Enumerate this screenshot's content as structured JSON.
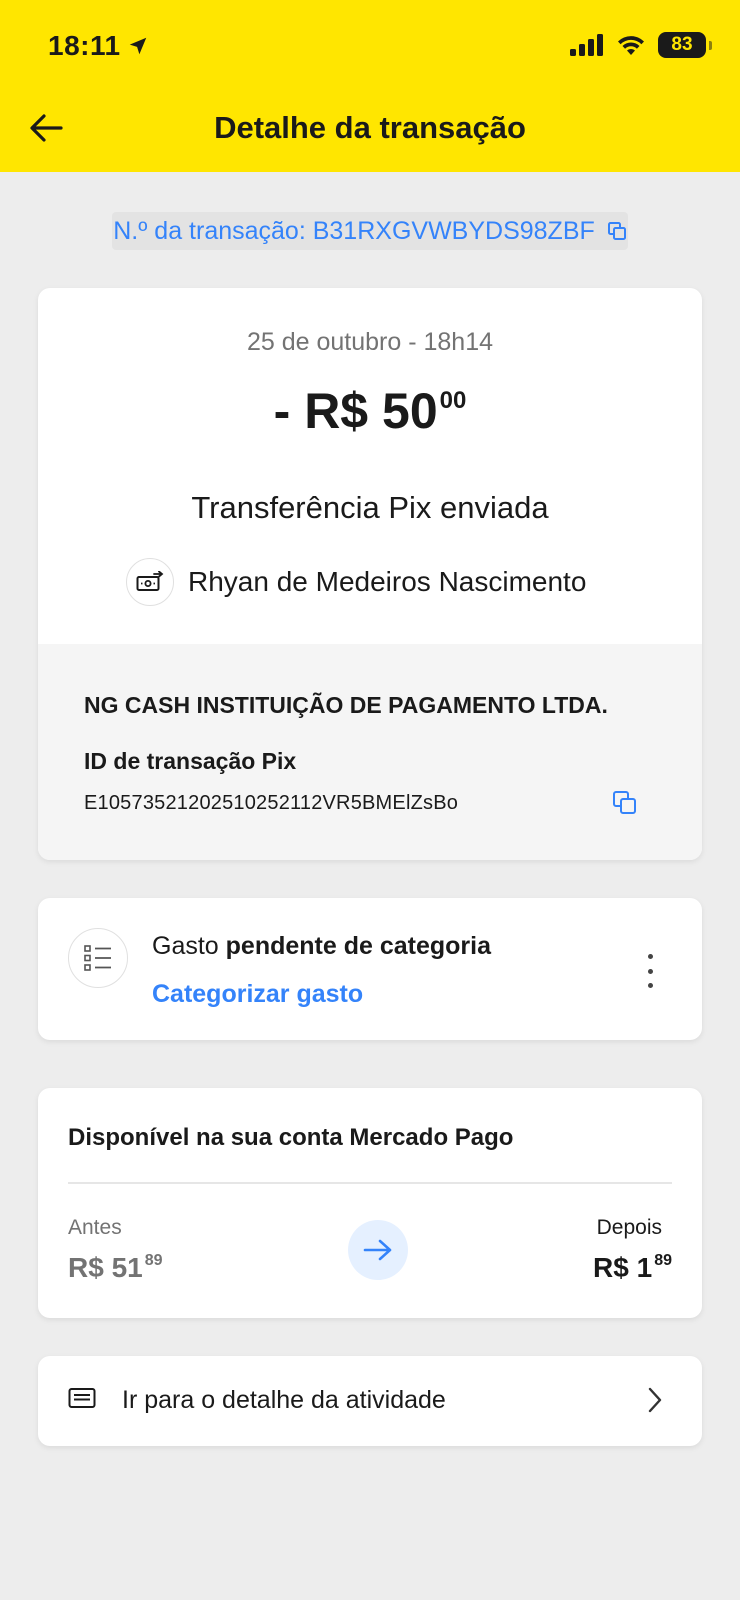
{
  "status_bar": {
    "time": "18:11",
    "battery": "83",
    "icons": [
      "location-arrow-icon",
      "signal-icon",
      "wifi-icon",
      "battery-icon"
    ]
  },
  "header": {
    "title": "Detalhe da transação",
    "back_icon": "arrow-left-icon",
    "background_color": "#ffe600"
  },
  "transaction_number": {
    "label": "N.º da transação: B31RXGVWBYDS98ZBF",
    "copy_icon": "copy-icon",
    "color": "#3483fa"
  },
  "summary": {
    "date": "25 de outubro - 18h14",
    "amount_main": "- R$ 50",
    "amount_cents": "00",
    "type": "Transferência Pix enviada",
    "recipient": "Rhyan de Medeiros Nascimento",
    "recipient_icon": "money-transfer-icon"
  },
  "bank_details": {
    "institution": "NG CASH INSTITUIÇÃO DE PAGAMENTO LTDA.",
    "pix_label": "ID de transação Pix",
    "pix_id": "E10573521202510252112VR5BMElZsBo",
    "copy_icon": "copy-icon"
  },
  "category": {
    "prefix": "Gasto ",
    "status": "pendente de categoria",
    "link": "Categorizar gasto",
    "icon": "list-icon",
    "menu_icon": "more-vertical-icon"
  },
  "balance": {
    "title": "Disponível na sua conta Mercado Pago",
    "before_label": "Antes",
    "before_main": "R$ 51",
    "before_cents": "89",
    "after_label": "Depois",
    "after_main": "R$ 1",
    "after_cents": "89",
    "arrow_icon": "arrow-right-icon"
  },
  "activity_link": {
    "label": "Ir para o detalhe da atividade",
    "icon": "receipt-icon",
    "chevron_icon": "chevron-right-icon"
  }
}
